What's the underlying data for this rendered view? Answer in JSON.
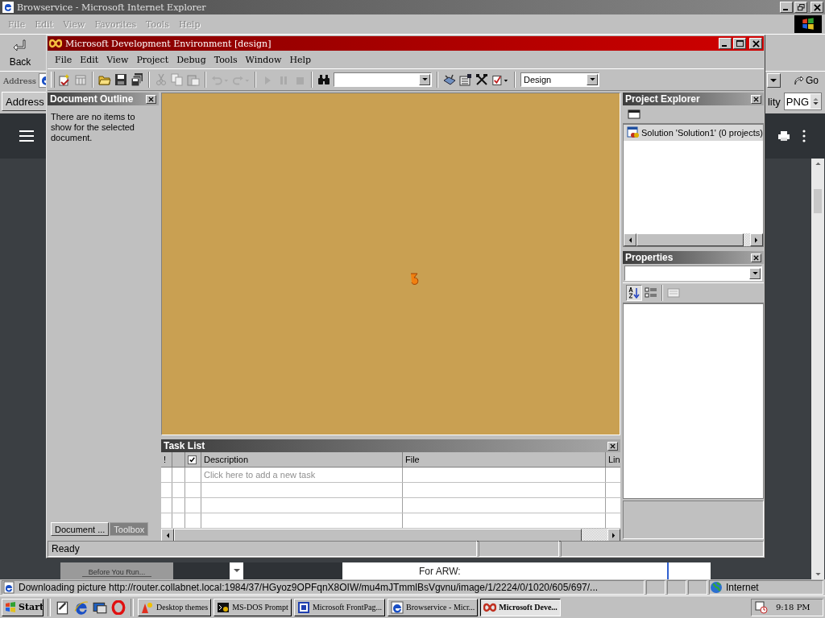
{
  "browser": {
    "title": "Browservice - Microsoft Internet Explorer",
    "menu": [
      {
        "label": "File",
        "disabled": true
      },
      {
        "label": "Edit",
        "disabled": true
      },
      {
        "label": "View",
        "disabled": true
      },
      {
        "label": "Favorites",
        "disabled": true
      },
      {
        "label": "Tools",
        "disabled": true
      },
      {
        "label": "Help",
        "disabled": true
      }
    ],
    "back_label": "Back",
    "address_label": "Address",
    "go_label": "Go",
    "page": {
      "address_button": "Address",
      "quality_label": "lity",
      "format_value": "PNG",
      "thumbnail_caption": "Before You Run...",
      "field_label": "For ARW:"
    },
    "status_text": "Downloading picture http://router.collabnet.local:1984/37/HGyoz9OPFqnX8OIW/mu4mJTmmlBsVgvnu/image/1/2224/0/1020/605/697/...",
    "zone": "Internet"
  },
  "ide": {
    "title": "Microsoft Development Environment [design]",
    "menu": [
      "File",
      "Edit",
      "View",
      "Project",
      "Debug",
      "Tools",
      "Window",
      "Help"
    ],
    "view_mode": "Design",
    "document_outline": {
      "title": "Document Outline",
      "message": "There are no items to show for the selected document."
    },
    "left_tabs": [
      {
        "label": "Document ...",
        "selected": true
      },
      {
        "label": "Toolbox",
        "selected": false
      }
    ],
    "task_list": {
      "title": "Task List",
      "columns": [
        {
          "kind": "text",
          "label": "!"
        },
        {
          "kind": "blank"
        },
        {
          "kind": "check"
        },
        {
          "kind": "text",
          "label": "Description"
        },
        {
          "kind": "text",
          "label": "File"
        },
        {
          "kind": "text",
          "label": "Lin"
        }
      ],
      "new_task_placeholder": "Click here to add a new task"
    },
    "project_explorer": {
      "title": "Project Explorer",
      "items": [
        {
          "label": "Solution 'Solution1' (0 projects)",
          "selected": true
        }
      ]
    },
    "properties": {
      "title": "Properties"
    },
    "status": "Ready"
  },
  "taskbar": {
    "start": "Start",
    "tasks": [
      {
        "label": "Desktop themes",
        "selected": false,
        "kind": "themes"
      },
      {
        "label": "MS-DOS Prompt",
        "selected": false,
        "kind": "dos"
      },
      {
        "label": "Microsoft FrontPag...",
        "selected": false,
        "kind": "frontpage"
      },
      {
        "label": "Browservice - Micr...",
        "selected": false,
        "kind": "ie"
      },
      {
        "label": "Microsoft Deve...",
        "selected": true,
        "kind": "devenv"
      }
    ],
    "clock": "9:18 PM"
  }
}
